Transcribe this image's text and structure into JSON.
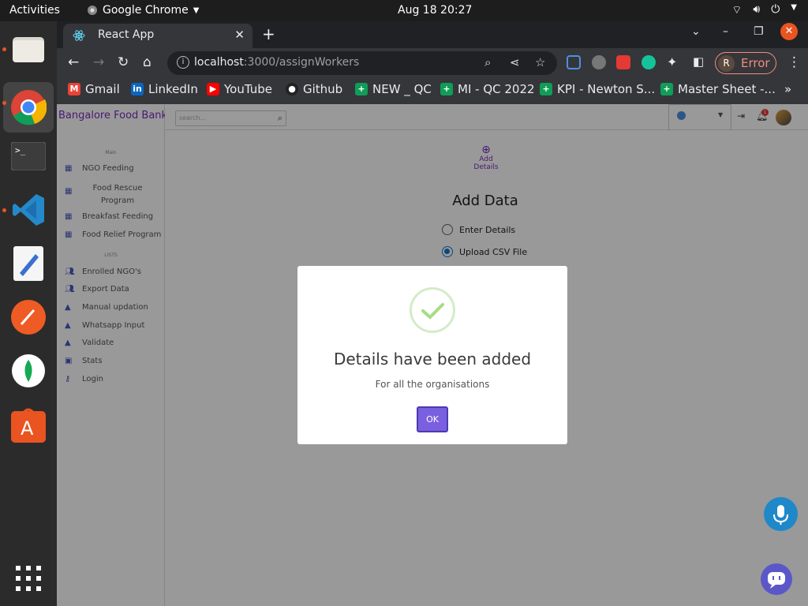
{
  "topbar": {
    "activities": "Activities",
    "app": "Google Chrome",
    "clock": "Aug 18  20:27"
  },
  "browser": {
    "tab_title": "React App",
    "url_host": "localhost",
    "url_path": ":3000/assignWorkers",
    "profile_initial": "R",
    "profile_status": "Error",
    "bookmarks": [
      "Gmail",
      "LinkedIn",
      "YouTube",
      "Github",
      "NEW _ QC",
      "MI - QC 2022",
      "KPI - Newton S...",
      "Master Sheet -..."
    ],
    "more": "»"
  },
  "app": {
    "brand": "Bangalore Food Bank",
    "search_placeholder": "search...",
    "notification_count": "1",
    "sidebar": {
      "section_main": "Main",
      "main_items": [
        "NGO Feeding",
        "Food Rescue Program",
        "Breakfast Feeding",
        "Food Relief Program"
      ],
      "section_lists": "LISTS",
      "list_items": [
        "Enrolled NGO's",
        "Export Data",
        "Manual updation",
        "Whatsapp Input",
        "Validate",
        "Stats",
        "Login"
      ]
    },
    "content": {
      "add_details_label": "Add Details",
      "heading": "Add Data",
      "option_enter": "Enter Details",
      "option_upload": "Upload CSV File",
      "selected_option": "Upload CSV File"
    }
  },
  "modal": {
    "title": "Details have been added",
    "message": "For all the organisations",
    "ok_label": "OK"
  },
  "colors": {
    "brand": "#7b2cbf",
    "ok_button": "#7a5fe0",
    "success_check": "#a5dc86",
    "mic_button": "#1f88c9",
    "chat_button": "#5b57c9"
  }
}
